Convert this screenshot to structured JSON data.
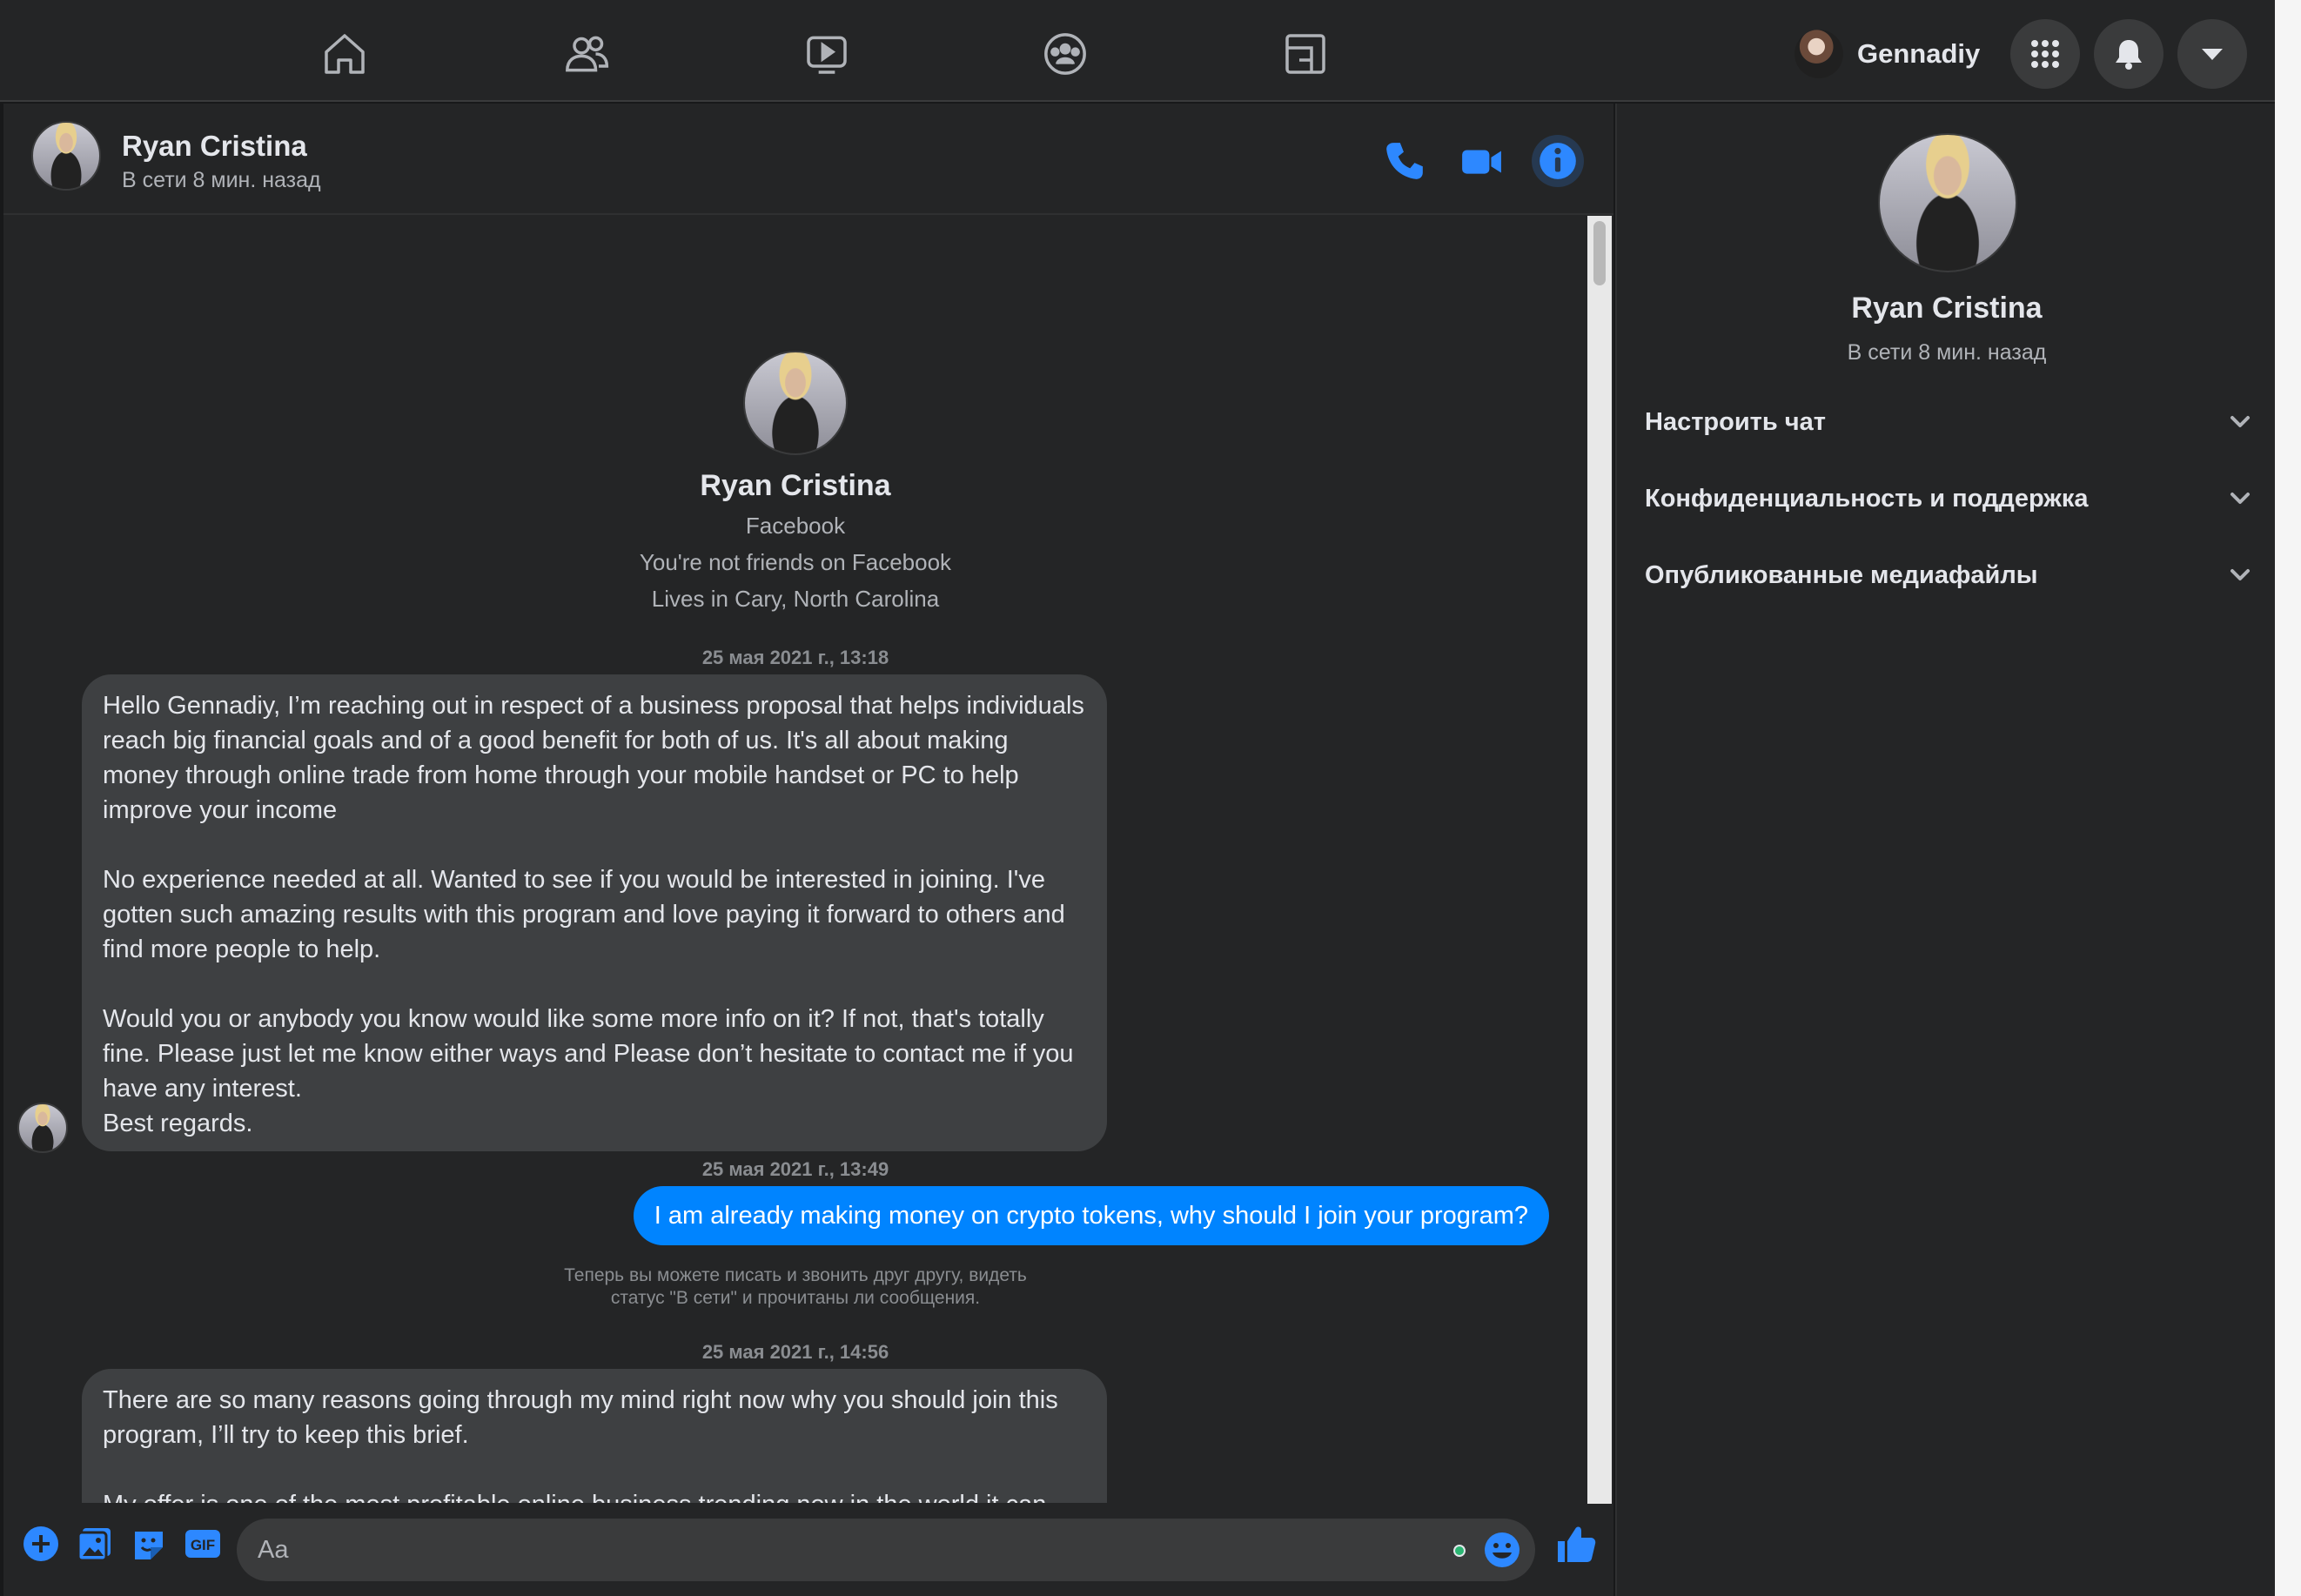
{
  "topbar": {
    "nav": [
      {
        "name": "home-icon"
      },
      {
        "name": "friends-icon"
      },
      {
        "name": "watch-icon"
      },
      {
        "name": "groups-icon"
      },
      {
        "name": "gaming-icon"
      }
    ],
    "user_name": "Gennadiy",
    "buttons": [
      "menu-grid-icon",
      "notifications-bell-icon",
      "account-dropdown-icon"
    ]
  },
  "chat": {
    "contact_name": "Ryan Cristina",
    "contact_status": "В сети 8 мин. назад",
    "intro": {
      "name": "Ryan Cristina",
      "source": "Facebook",
      "friend_status": "You're not friends on Facebook",
      "location": "Lives in Cary, North Carolina"
    },
    "messages": [
      {
        "timestamp": "25 мая 2021 г., 13:18",
        "direction": "in",
        "paragraphs": [
          "Hello Gennadiy, I’m reaching out in respect of a business proposal that helps individuals reach big financial goals and of a good benefit for both of us. It's all about making money through online trade from home through your mobile handset or PC to help improve your income",
          "No experience needed at all. Wanted to see if you would be interested in joining. I've gotten such amazing results with this program and love paying it forward to others and find more people to help.",
          "Would you or anybody you know would like some more info on it? If not, that's totally fine. Please just let me know either ways and Please don’t hesitate to contact me if you have any interest.\nBest regards."
        ]
      },
      {
        "timestamp": "25 мая 2021 г., 13:49",
        "direction": "out",
        "text": "I am already making money on crypto tokens, why should I join your program?"
      },
      {
        "system_note": "Теперь вы можете писать и звонить друг другу, видеть статус \"В сети\" и прочитаны ли сообщения."
      },
      {
        "timestamp": "25 мая 2021 г., 14:56",
        "direction": "in",
        "paragraphs": [
          "There are so many reasons going through my mind right now why you should join this program, I’ll try to keep this brief.",
          "My offer is one of the most profitable online business trending now in the world it can serve as a short term investment which can provide a second consistent source of income its legit and also the most reliable global wealth creation highly profitable in the online trading business my friend"
        ]
      }
    ],
    "composer": {
      "placeholder": "Aa"
    }
  },
  "info_panel": {
    "name": "Ryan Cristina",
    "status": "В сети 8 мин. назад",
    "sections": [
      {
        "label": "Настроить чат"
      },
      {
        "label": "Конфиденциальность и поддержка"
      },
      {
        "label": "Опубликованные медиафайлы"
      }
    ]
  },
  "colors": {
    "accent": "#2d88ff",
    "outgoing_bubble": "#0084ff",
    "incoming_bubble": "#3e4042",
    "surface": "#242526"
  }
}
